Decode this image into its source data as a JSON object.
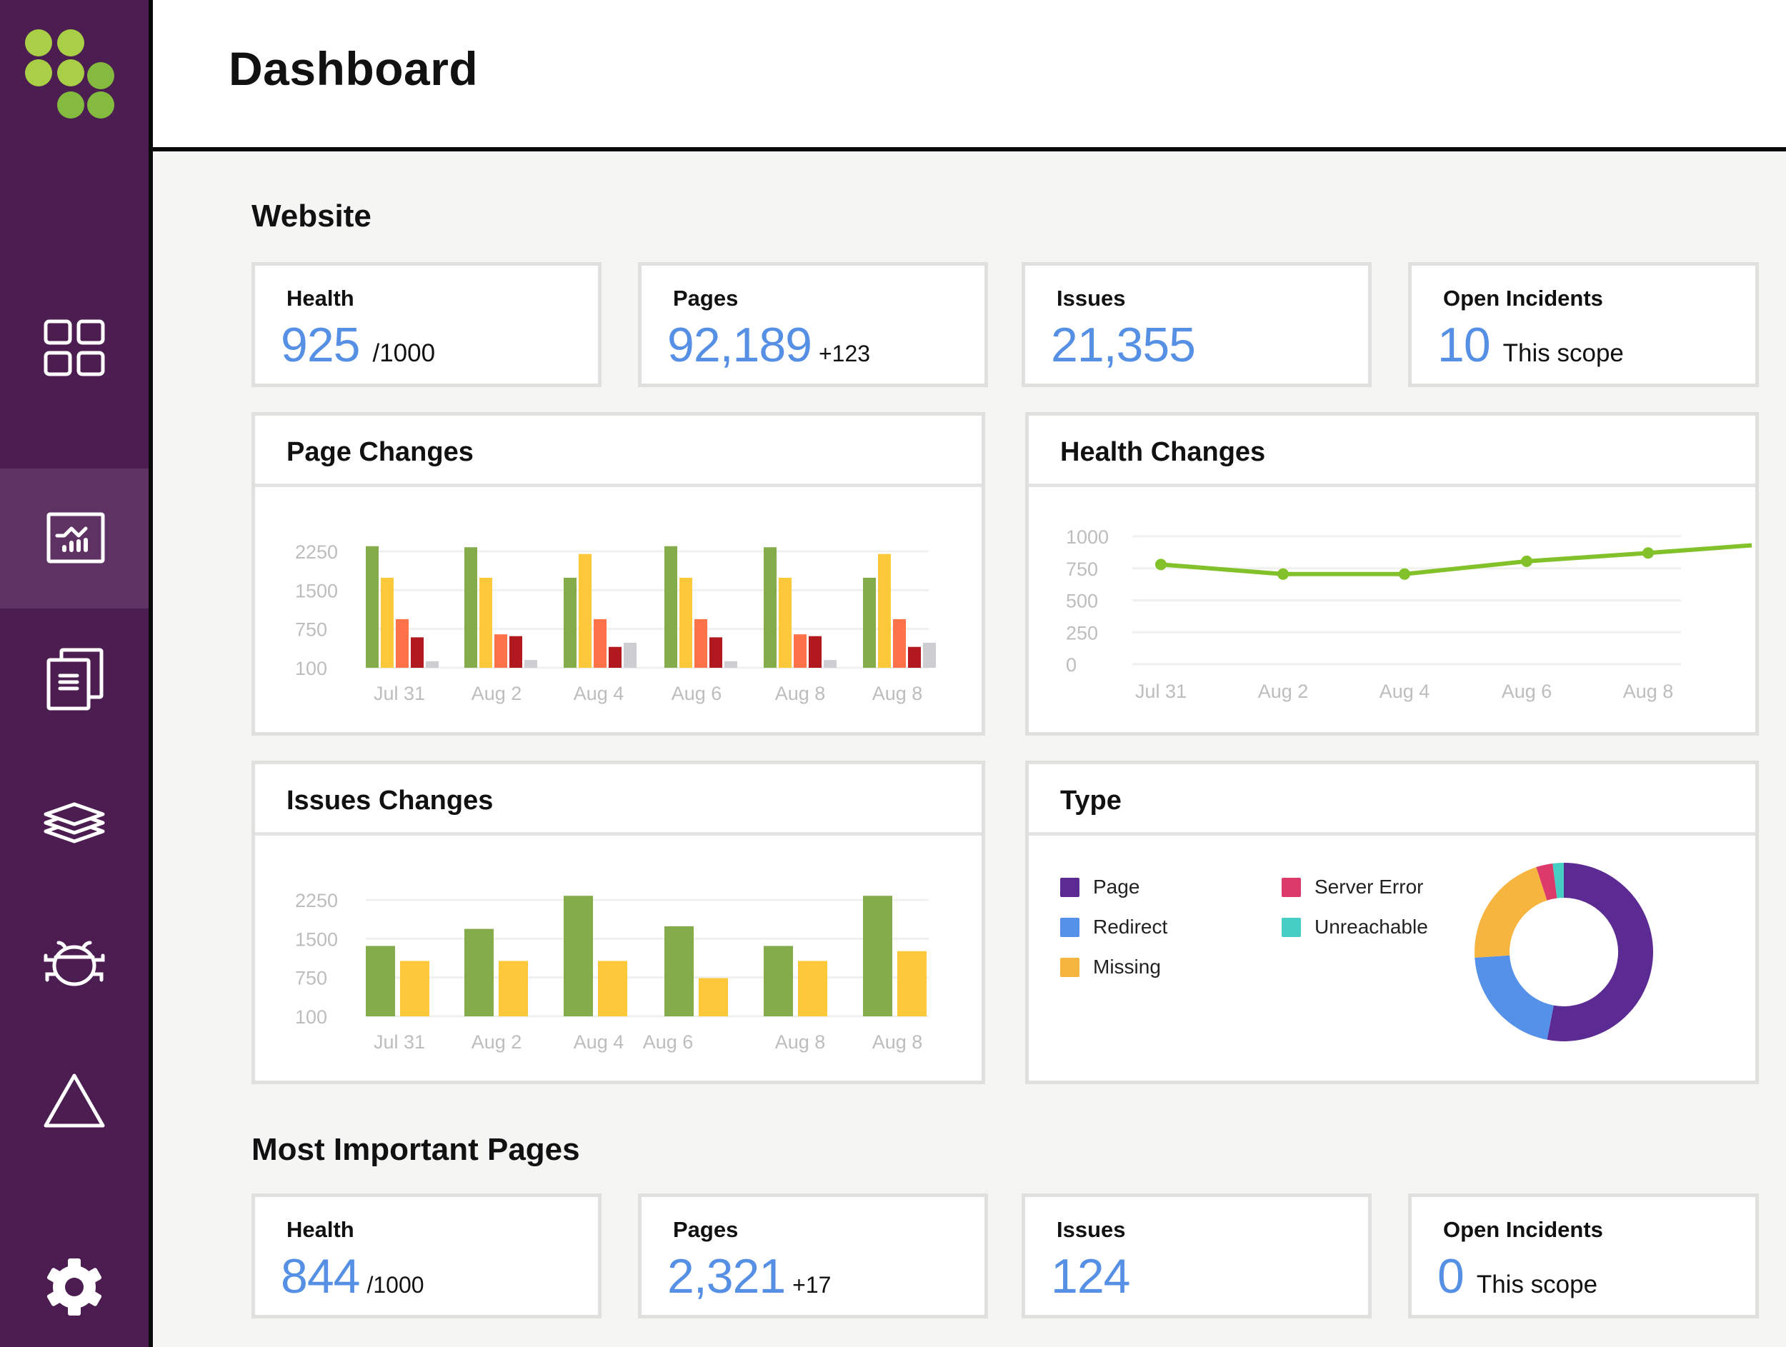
{
  "app": {
    "title": "Dashboard"
  },
  "sidebar": {
    "items": [
      {
        "name": "overview",
        "icon": "grid-icon",
        "active": false
      },
      {
        "name": "analytics",
        "icon": "chart-icon",
        "active": true
      },
      {
        "name": "documents",
        "icon": "documents-icon",
        "active": false
      },
      {
        "name": "layers",
        "icon": "layers-icon",
        "active": false
      },
      {
        "name": "bugs",
        "icon": "bug-icon",
        "active": false
      },
      {
        "name": "alerts",
        "icon": "triangle-icon",
        "active": false
      },
      {
        "name": "settings",
        "icon": "gear-icon",
        "active": false
      }
    ]
  },
  "website": {
    "section_title": "Website",
    "stats": [
      {
        "label": "Health",
        "value": "925",
        "suffix": "/1000"
      },
      {
        "label": "Pages",
        "value": "92,189",
        "suffix": "+123"
      },
      {
        "label": "Issues",
        "value": "21,355",
        "suffix": ""
      },
      {
        "label": "Open Incidents",
        "value": "10",
        "suffix": "This scope"
      }
    ]
  },
  "important": {
    "section_title": "Most Important Pages",
    "stats": [
      {
        "label": "Health",
        "value": "844",
        "suffix": "/1000"
      },
      {
        "label": "Pages",
        "value": "2,321",
        "suffix": "+17"
      },
      {
        "label": "Issues",
        "value": "124",
        "suffix": ""
      },
      {
        "label": "Open Incidents",
        "value": "0",
        "suffix": "This scope"
      }
    ]
  },
  "panels": {
    "page_changes": "Page Changes",
    "health_changes": "Health Changes",
    "issues_changes": "Issues Changes",
    "type": "Type"
  },
  "colors": {
    "accent_blue": "#5590E4",
    "sidebar": "#4C1D50",
    "sidebar_active": "#5E3363",
    "logo_light": "#A8CF45",
    "logo_dark": "#84BB3F"
  },
  "chart_data": [
    {
      "id": "page_changes",
      "type": "bar",
      "title": "Page Changes",
      "categories": [
        "Jul 31",
        "Aug 2",
        "Aug 4",
        "Aug 6",
        "Aug 8",
        "Aug 8"
      ],
      "yticks": [
        100,
        750,
        1500,
        2250
      ],
      "ylim": [
        100,
        2250
      ],
      "grid": true,
      "series": [
        {
          "name": "series-1",
          "color": "#84AC4B",
          "values": [
            2350,
            2330,
            1740,
            2350,
            2330,
            1740
          ]
        },
        {
          "name": "series-2",
          "color": "#FDC93B",
          "values": [
            1740,
            1740,
            2200,
            1740,
            1740,
            2200
          ]
        },
        {
          "name": "series-3",
          "color": "#FE724A",
          "values": [
            940,
            660,
            940,
            940,
            660,
            940
          ]
        },
        {
          "name": "series-4",
          "color": "#B2191F",
          "values": [
            610,
            630,
            450,
            610,
            630,
            450
          ]
        },
        {
          "name": "series-5",
          "color": "#CDCDD2",
          "values": [
            210,
            230,
            520,
            210,
            230,
            520
          ]
        }
      ]
    },
    {
      "id": "health_changes",
      "type": "line",
      "title": "Health Changes",
      "categories": [
        "Jul 31",
        "Aug 2",
        "Aug 4",
        "Aug 6",
        "Aug 8",
        ""
      ],
      "yticks": [
        0,
        250,
        500,
        750,
        1000
      ],
      "ylim": [
        0,
        1000
      ],
      "grid": true,
      "series": [
        {
          "name": "Health",
          "color": "#82C12A",
          "values": [
            780,
            705,
            705,
            805,
            870,
            930
          ]
        }
      ]
    },
    {
      "id": "issues_changes",
      "type": "bar",
      "title": "Issues Changes",
      "categories": [
        "Jul 31",
        "Aug 2",
        "Aug 4",
        "Aug 6",
        "Aug 8",
        "Aug 8"
      ],
      "yticks": [
        100,
        750,
        1500,
        2250
      ],
      "ylim": [
        100,
        2250
      ],
      "grid": true,
      "series": [
        {
          "name": "series-1",
          "color": "#84AC4B",
          "values": [
            1360,
            1690,
            2330,
            1740,
            1360,
            2330
          ]
        },
        {
          "name": "series-2",
          "color": "#FDC93B",
          "values": [
            1070,
            1070,
            1070,
            740,
            1070,
            1260
          ]
        }
      ]
    },
    {
      "id": "type",
      "type": "pie",
      "title": "Type",
      "legend_position": "left",
      "slices": [
        {
          "label": "Page",
          "value": 53,
          "color": "#5B2A92"
        },
        {
          "label": "Redirect",
          "value": 21,
          "color": "#5591E8"
        },
        {
          "label": "Missing",
          "value": 21,
          "color": "#F6B53F"
        },
        {
          "label": "Server Error",
          "value": 3,
          "color": "#DC3A6A"
        },
        {
          "label": "Unreachable",
          "value": 2,
          "color": "#46CDC4"
        }
      ]
    }
  ]
}
